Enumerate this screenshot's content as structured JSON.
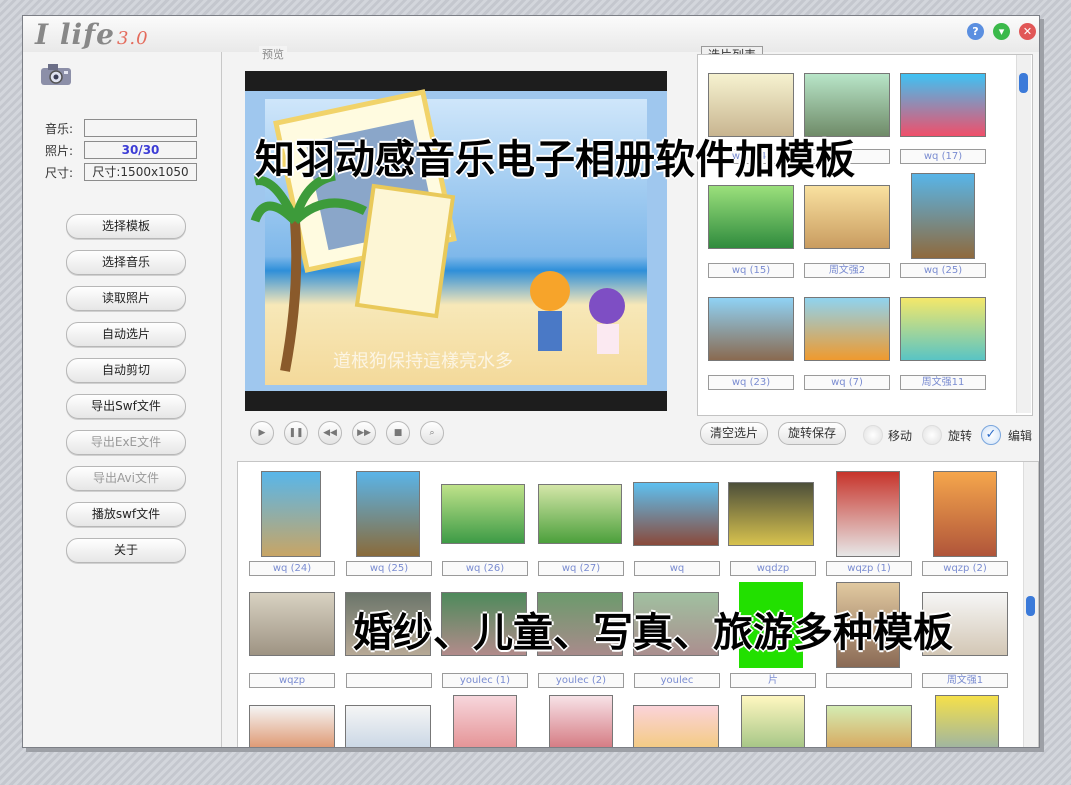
{
  "app": {
    "logo_main": "I life",
    "logo_version": "3.0"
  },
  "window_buttons": {
    "help": "?",
    "minimize": "▾",
    "close": "✕"
  },
  "info": {
    "music_label": "音乐:",
    "music_value": "",
    "photo_label": "照片:",
    "photo_value": "30/30",
    "size_label": "尺寸:",
    "size_value": "尺寸:1500x1050"
  },
  "buttons": [
    {
      "label": "选择模板",
      "enabled": true
    },
    {
      "label": "选择音乐",
      "enabled": true
    },
    {
      "label": "读取照片",
      "enabled": true
    },
    {
      "label": "自动选片",
      "enabled": true
    },
    {
      "label": "自动剪切",
      "enabled": true
    },
    {
      "label": "导出Swf文件",
      "enabled": true
    },
    {
      "label": "导出ExE文件",
      "enabled": false
    },
    {
      "label": "导出Avi文件",
      "enabled": false
    },
    {
      "label": "播放swf文件",
      "enabled": true
    },
    {
      "label": "关于",
      "enabled": true
    }
  ],
  "preview": {
    "label": "预览",
    "caption": "道根狗保持這樣亮水多",
    "controls": [
      "▶",
      "❚❚",
      "◀◀",
      "▶▶",
      "■",
      "⌕"
    ]
  },
  "selection": {
    "label": "选片列表",
    "items": [
      "wq (14)",
      "",
      "wq (17)",
      "wq (15)",
      "周文强2",
      "wq (25)",
      "wq (23)",
      "wq (7)",
      "周文强11"
    ],
    "clear_button": "清空选片",
    "rotate_save_button": "旋转保存",
    "move_label": "移动",
    "rotate_label": "旋转",
    "edit_label": "编辑"
  },
  "library": {
    "row1": [
      "wq (24)",
      "wq (25)",
      "wq (26)",
      "wq (27)",
      "wq",
      "wqdzp",
      "wqzp (1)",
      "wqzp (2)"
    ],
    "row2": [
      "wqzp",
      "",
      "youlec (1)",
      "youlec (2)",
      "youlec",
      "片",
      "",
      "周文强1"
    ]
  },
  "overlays": {
    "top": "知羽动感音乐电子相册软件加模板",
    "bottom": "婚纱、儿童、写真、旅游多种模板"
  },
  "colors": {
    "accent": "#3c3cd6",
    "caption_text": "#7a8cd1",
    "highlight_green": "#22e000"
  }
}
